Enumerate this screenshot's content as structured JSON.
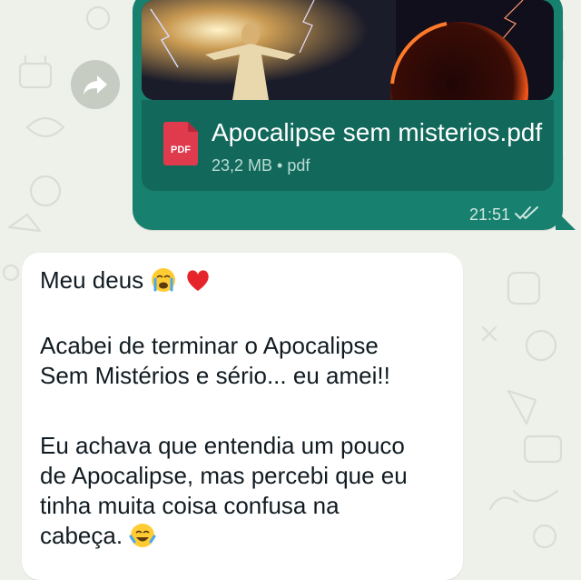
{
  "attachment": {
    "file_name": "Apocalipse sem misterios.pdf",
    "file_meta": "23,2 MB • pdf",
    "icon_label": "PDF",
    "time": "21:51",
    "status": "read"
  },
  "message": {
    "line1": "Meu deus",
    "para2_line1": "Acabei de terminar o Apocalipse",
    "para2_line2": "Sem Mistérios e sério... eu amei!!",
    "para3_line1": "Eu achava que entendia um pouco",
    "para3_line2": "de Apocalipse, mas percebi que eu",
    "para3_line3": "tinha muita coisa confusa na",
    "para3_line4": "cabeça."
  },
  "colors": {
    "outgoing_bubble": "#17806e",
    "file_card": "#12695b",
    "pdf_badge": "#e03a4d",
    "background": "#eef1ea"
  }
}
